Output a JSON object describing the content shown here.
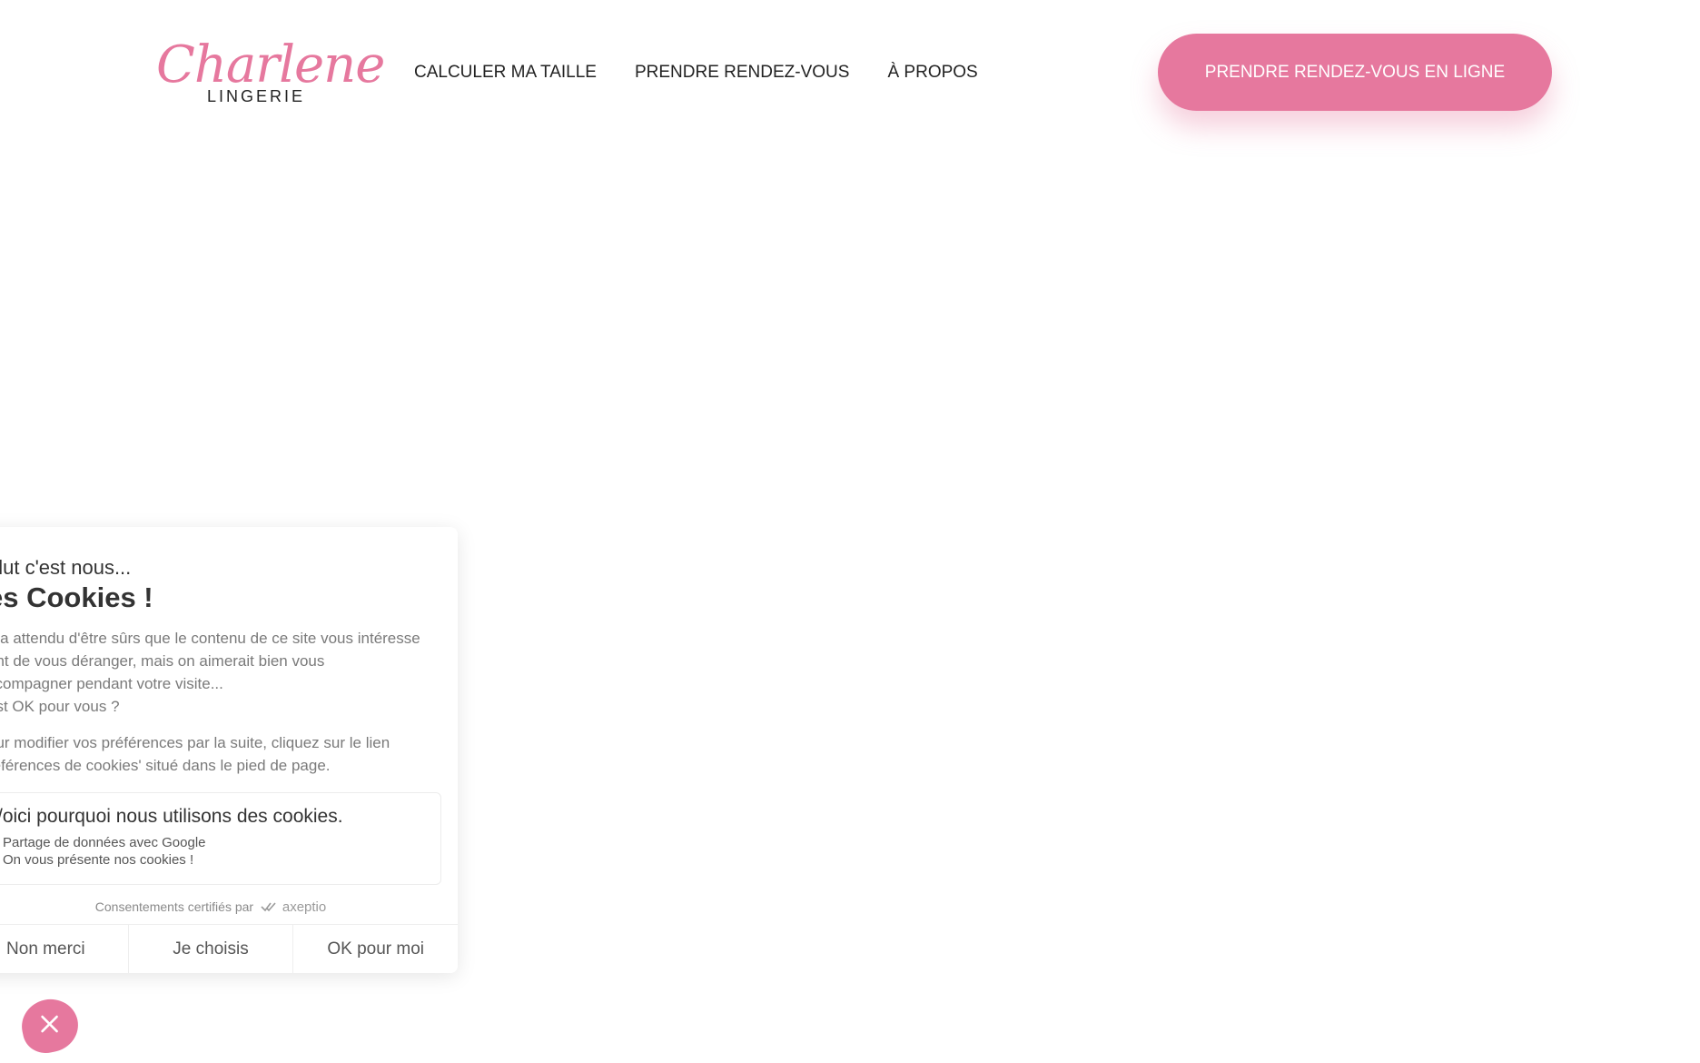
{
  "header": {
    "logo": {
      "script": "Charlene",
      "sub": "LINGERIE"
    },
    "nav": [
      {
        "label": "CALCULER MA TAILLE"
      },
      {
        "label": "PRENDRE RENDEZ-VOUS"
      },
      {
        "label": "À PROPOS"
      }
    ],
    "cta_label": "PRENDRE RENDEZ-VOUS EN LIGNE"
  },
  "cookie_panel": {
    "hello": "alut c'est nous...",
    "title": "es Cookies !",
    "paragraph1": [
      "n a attendu d'être sûrs que le contenu de ce site vous intéresse",
      "ant de vous déranger, mais on aimerait bien vous",
      "ccompagner pendant votre visite...",
      "est OK pour vous ?"
    ],
    "paragraph2": [
      "our modifier vos préférences par la suite, cliquez sur le lien",
      "références de cookies' situé dans le pied de page."
    ],
    "reasons": {
      "title": "/oici pourquoi nous utilisons des cookies.",
      "items": [
        "Partage de données avec Google",
        "On vous présente nos cookies !"
      ]
    },
    "certified_text": "Consentements certifiés par",
    "certified_brand": "axeptio",
    "buttons": {
      "refuse": "Non merci",
      "choose": "Je choisis",
      "accept": "OK pour moi"
    }
  },
  "colors": {
    "brand_pink": "#e6789e",
    "text_dark": "#222222",
    "text_muted": "#7a7a7a"
  },
  "icons": {
    "close_bubble": "close-icon",
    "certified_mark": "check-icon"
  }
}
